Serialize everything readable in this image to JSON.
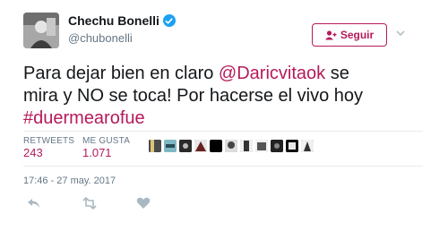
{
  "user": {
    "name": "Chechu Bonelli",
    "handle": "@chubonelli"
  },
  "follow_button": {
    "label": "Seguir"
  },
  "tweet": {
    "line1_pre": "Para dejar bien en claro ",
    "line1_mention": "@Daricvitaok",
    "line1_post": " se",
    "line2": "mira y NO se toca! Por hacerse el vivo hoy",
    "hashtag": "#duermearofue"
  },
  "stats": {
    "retweets_label": "RETWEETS",
    "retweets_value": "243",
    "likes_label": "ME GUSTA",
    "likes_value": "1.071"
  },
  "timestamp": "17:46 - 27 may. 2017",
  "colors": {
    "accent": "#b51a5b",
    "verified": "#1da1f2",
    "muted": "#657786",
    "divider": "#e6ecf0"
  },
  "icons": {
    "reply": "reply-icon",
    "retweet": "retweet-icon",
    "like": "heart-icon",
    "more": "chevron-down-icon"
  }
}
